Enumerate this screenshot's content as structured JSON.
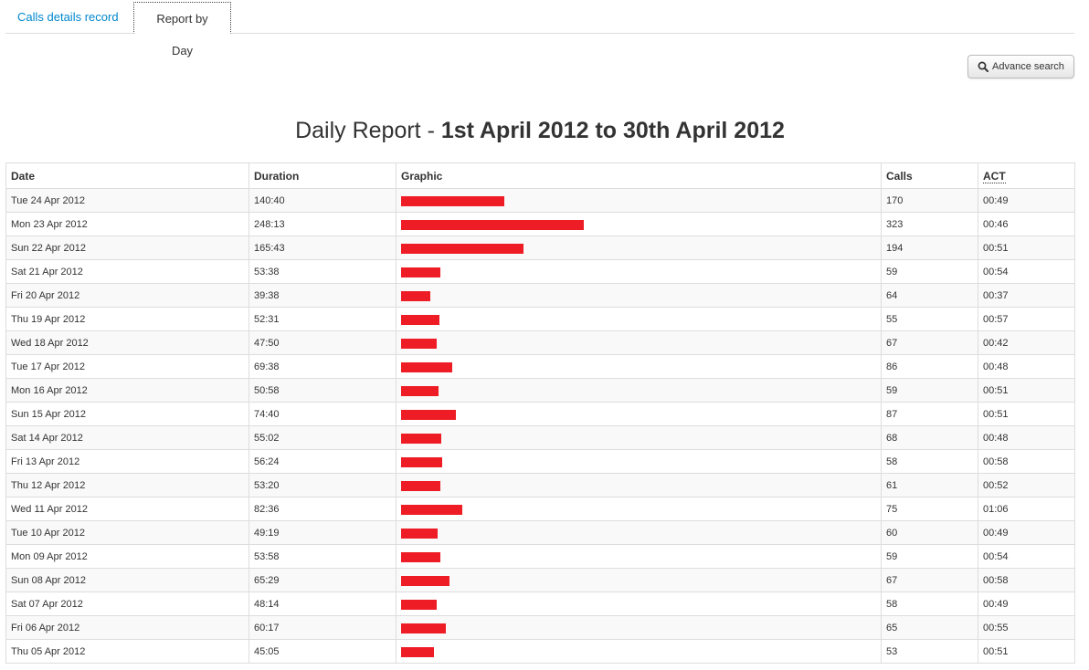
{
  "tabs": [
    {
      "label": "Calls details record",
      "active": false
    },
    {
      "label": "Report by Day",
      "active": true
    }
  ],
  "advance_search": {
    "label": "Advance search",
    "icon": "search-icon"
  },
  "report": {
    "title_prefix": "Daily Report - ",
    "title_range": "1st April 2012 to 30th April 2012"
  },
  "table": {
    "headers": {
      "date": "Date",
      "duration": "Duration",
      "graphic": "Graphic",
      "calls": "Calls",
      "act": "ACT"
    },
    "bar_color": "#ee1c24",
    "rows": [
      {
        "date": "Tue 24 Apr 2012",
        "duration": "140:40",
        "calls": "170",
        "act": "00:49"
      },
      {
        "date": "Mon 23 Apr 2012",
        "duration": "248:13",
        "calls": "323",
        "act": "00:46"
      },
      {
        "date": "Sun 22 Apr 2012",
        "duration": "165:43",
        "calls": "194",
        "act": "00:51"
      },
      {
        "date": "Sat 21 Apr 2012",
        "duration": "53:38",
        "calls": "59",
        "act": "00:54"
      },
      {
        "date": "Fri 20 Apr 2012",
        "duration": "39:38",
        "calls": "64",
        "act": "00:37"
      },
      {
        "date": "Thu 19 Apr 2012",
        "duration": "52:31",
        "calls": "55",
        "act": "00:57"
      },
      {
        "date": "Wed 18 Apr 2012",
        "duration": "47:50",
        "calls": "67",
        "act": "00:42"
      },
      {
        "date": "Tue 17 Apr 2012",
        "duration": "69:38",
        "calls": "86",
        "act": "00:48"
      },
      {
        "date": "Mon 16 Apr 2012",
        "duration": "50:58",
        "calls": "59",
        "act": "00:51"
      },
      {
        "date": "Sun 15 Apr 2012",
        "duration": "74:40",
        "calls": "87",
        "act": "00:51"
      },
      {
        "date": "Sat 14 Apr 2012",
        "duration": "55:02",
        "calls": "68",
        "act": "00:48"
      },
      {
        "date": "Fri 13 Apr 2012",
        "duration": "56:24",
        "calls": "58",
        "act": "00:58"
      },
      {
        "date": "Thu 12 Apr 2012",
        "duration": "53:20",
        "calls": "61",
        "act": "00:52"
      },
      {
        "date": "Wed 11 Apr 2012",
        "duration": "82:36",
        "calls": "75",
        "act": "01:06"
      },
      {
        "date": "Tue 10 Apr 2012",
        "duration": "49:19",
        "calls": "60",
        "act": "00:49"
      },
      {
        "date": "Mon 09 Apr 2012",
        "duration": "53:58",
        "calls": "59",
        "act": "00:54"
      },
      {
        "date": "Sun 08 Apr 2012",
        "duration": "65:29",
        "calls": "67",
        "act": "00:58"
      },
      {
        "date": "Sat 07 Apr 2012",
        "duration": "48:14",
        "calls": "58",
        "act": "00:49"
      },
      {
        "date": "Fri 06 Apr 2012",
        "duration": "60:17",
        "calls": "65",
        "act": "00:55"
      },
      {
        "date": "Thu 05 Apr 2012",
        "duration": "45:05",
        "calls": "53",
        "act": "00:51"
      }
    ]
  }
}
